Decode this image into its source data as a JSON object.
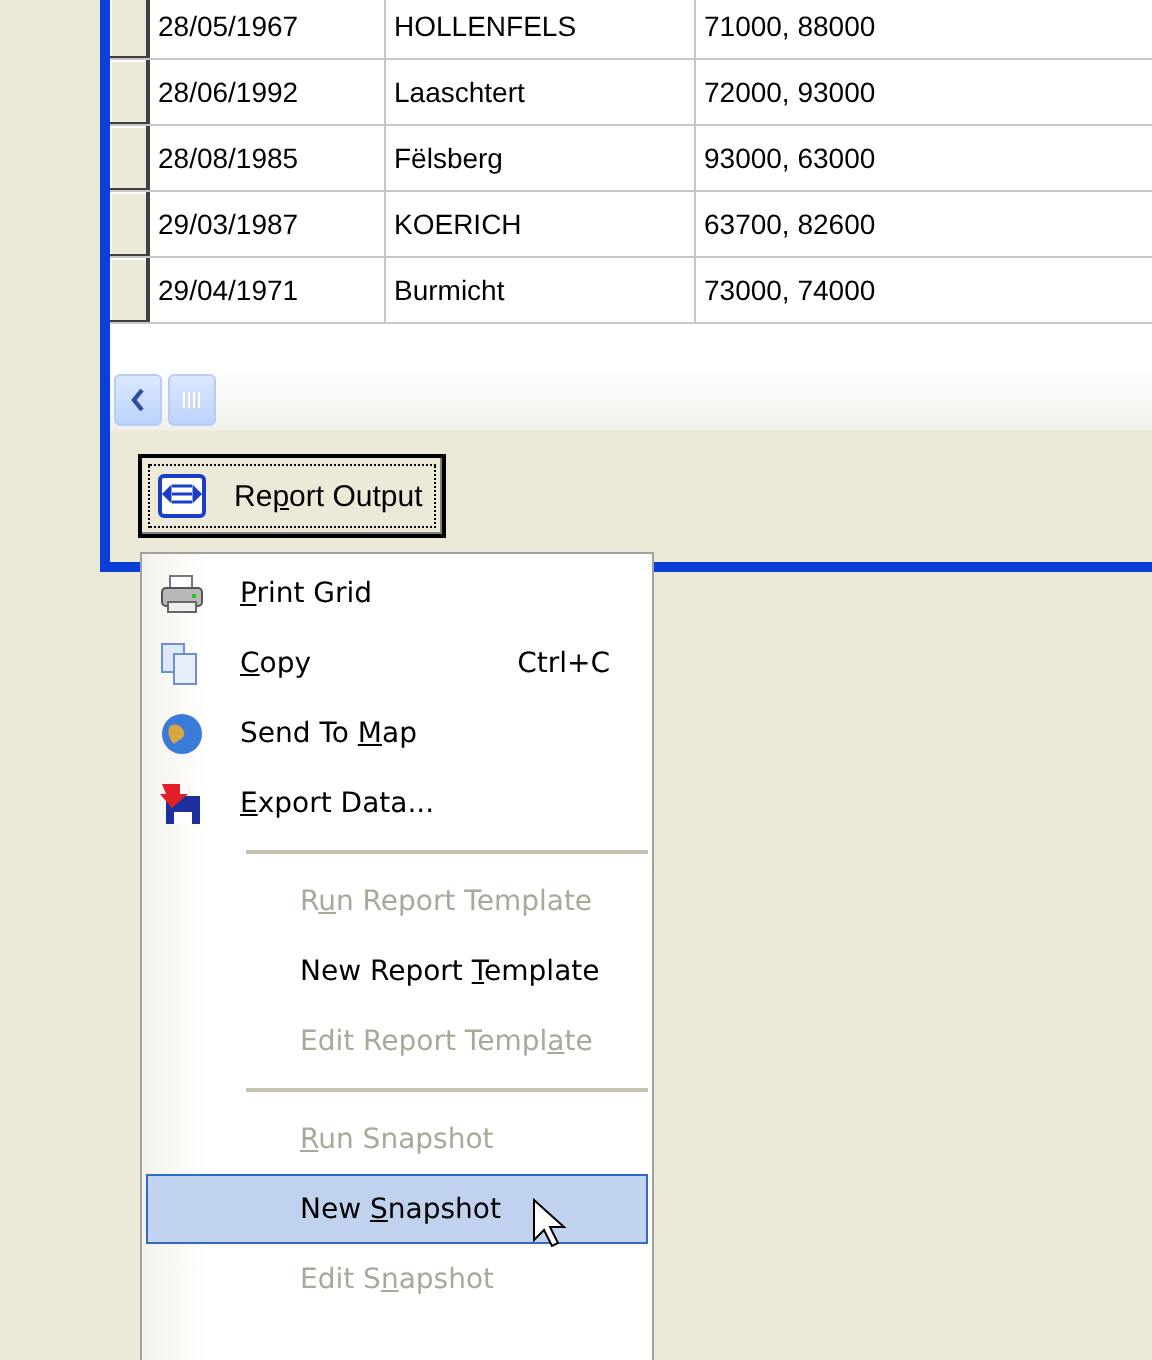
{
  "grid": {
    "rows": [
      {
        "date": "28/05/1967",
        "place": "HOLLENFELS",
        "coords": "71000, 88000"
      },
      {
        "date": "28/06/1992",
        "place": "Laaschtert",
        "coords": "72000, 93000"
      },
      {
        "date": "28/08/1985",
        "place": "Fëlsberg",
        "coords": "93000, 63000"
      },
      {
        "date": "29/03/1987",
        "place": "KOERICH",
        "coords": "63700, 82600"
      },
      {
        "date": "29/04/1971",
        "place": "Burmicht",
        "coords": "73000, 74000"
      }
    ]
  },
  "report_button": {
    "before": "Re",
    "key": "p",
    "after": "ort Output"
  },
  "menu": {
    "items": [
      {
        "kind": "item",
        "key": "P",
        "after": "rint Grid",
        "disabled": false,
        "selected": false
      },
      {
        "kind": "item",
        "key": "C",
        "after": "opy",
        "shortcut": "Ctrl+C",
        "disabled": false,
        "selected": false
      },
      {
        "kind": "item",
        "before": "Send To ",
        "key": "M",
        "after": "ap",
        "disabled": false,
        "selected": false
      },
      {
        "kind": "item",
        "key": "E",
        "after": "xport Data...",
        "disabled": false,
        "selected": false
      },
      {
        "kind": "separator"
      },
      {
        "kind": "item",
        "before": "R",
        "key": "u",
        "after": "n Report Template",
        "disabled": true,
        "selected": false
      },
      {
        "kind": "item",
        "before": "New Report ",
        "key": "T",
        "after": "emplate",
        "disabled": false,
        "selected": false
      },
      {
        "kind": "item",
        "before": "Edit Report Templ",
        "key": "a",
        "after": "te",
        "disabled": true,
        "selected": false
      },
      {
        "kind": "separator"
      },
      {
        "kind": "item",
        "key": "R",
        "after": "un Snapshot",
        "disabled": true,
        "selected": false
      },
      {
        "kind": "item",
        "before": "New ",
        "key": "S",
        "after": "napshot",
        "disabled": false,
        "selected": true
      },
      {
        "kind": "item",
        "before": "Edit S",
        "key": "n",
        "after": "apshot",
        "disabled": true,
        "selected": false
      }
    ]
  }
}
